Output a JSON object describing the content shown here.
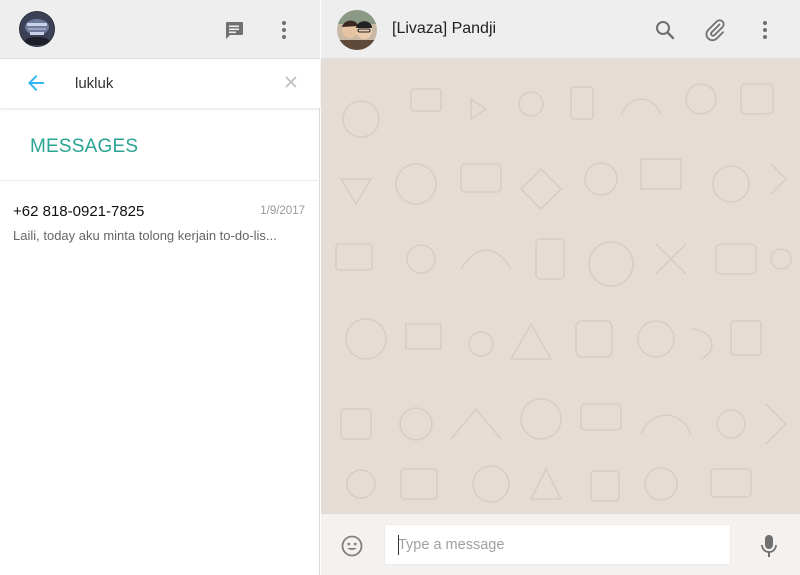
{
  "colors": {
    "accent": "#2aa493",
    "chat_background": "#e5ddd5",
    "header": "#eeeeee",
    "back_arrow": "#33b7f6"
  },
  "sidebar": {
    "header": {
      "avatar_icon": "profile-avatar",
      "icons": [
        "new-chat-icon",
        "menu-dots-icon"
      ]
    },
    "search": {
      "value": "lukluk",
      "back_icon": "arrow-left-icon",
      "clear_icon": "close-icon"
    },
    "section_heading": "MESSAGES",
    "results": [
      {
        "title": "+62 818-0921-7825",
        "date": "1/9/2017",
        "snippet": "Laili, today aku minta tolong kerjain to-do-lis..."
      }
    ]
  },
  "chat": {
    "contact_name": "[Livaza] Pandji",
    "header_icons": [
      "search-icon",
      "paperclip-icon",
      "menu-dots-icon"
    ],
    "composer": {
      "placeholder": "Type a message",
      "emoji_icon": "smiley-icon",
      "mic_icon": "microphone-icon"
    }
  }
}
